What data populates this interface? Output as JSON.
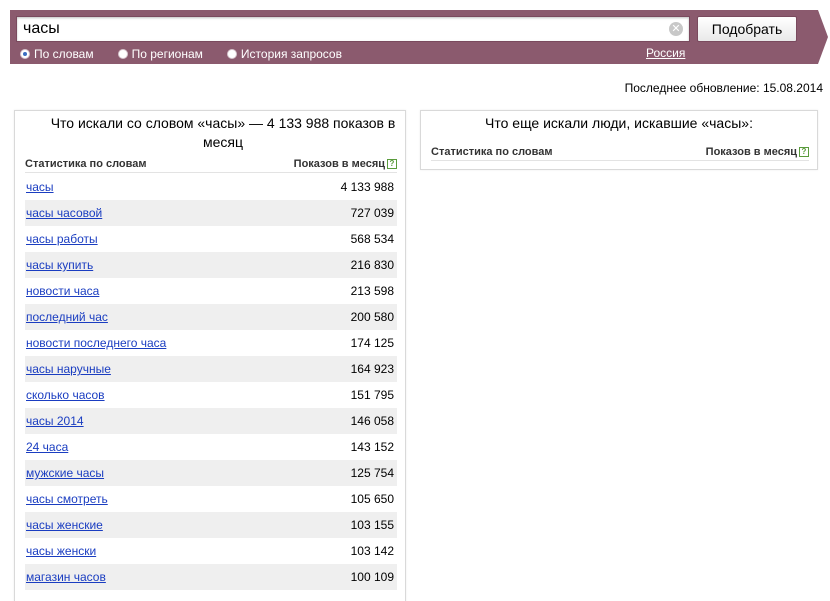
{
  "search": {
    "query": "часы",
    "submit_label": "Подобрать",
    "clear_glyph": "✕"
  },
  "modes": [
    {
      "label": "По словам",
      "checked": true
    },
    {
      "label": "По регионам",
      "checked": false
    },
    {
      "label": "История запросов",
      "checked": false
    }
  ],
  "region": "Россия",
  "last_update": "Последнее обновление: 15.08.2014",
  "left_panel": {
    "title": "Что искали со словом «часы» — 4 133 988 показов в месяц",
    "col_words": "Статистика по словам",
    "col_count": "Показов в месяц",
    "help_glyph": "?",
    "rows": [
      {
        "word": "часы",
        "count": "4 133 988"
      },
      {
        "word": "часы часовой",
        "count": "727 039"
      },
      {
        "word": "часы работы",
        "count": "568 534"
      },
      {
        "word": "часы купить",
        "count": "216 830"
      },
      {
        "word": "новости часа",
        "count": "213 598"
      },
      {
        "word": "последний час",
        "count": "200 580"
      },
      {
        "word": "новости последнего часа",
        "count": "174 125"
      },
      {
        "word": "часы наручные",
        "count": "164 923"
      },
      {
        "word": "сколько часов",
        "count": "151 795"
      },
      {
        "word": "часы 2014",
        "count": "146 058"
      },
      {
        "word": "24 часа",
        "count": "143 152"
      },
      {
        "word": "мужские часы",
        "count": "125 754"
      },
      {
        "word": "часы смотреть",
        "count": "105 650"
      },
      {
        "word": "часы женские",
        "count": "103 155"
      },
      {
        "word": "часы женски",
        "count": "103 142"
      },
      {
        "word": "магазин часов",
        "count": "100 109"
      }
    ]
  },
  "right_panel": {
    "title": "Что еще искали люди, искавшие «часы»:",
    "col_words": "Статистика по словам",
    "col_count": "Показов в месяц",
    "help_glyph": "?"
  },
  "colors": {
    "topbar": "#8b5a6e",
    "link": "#1a3dc1",
    "row_alt": "#efefef"
  }
}
